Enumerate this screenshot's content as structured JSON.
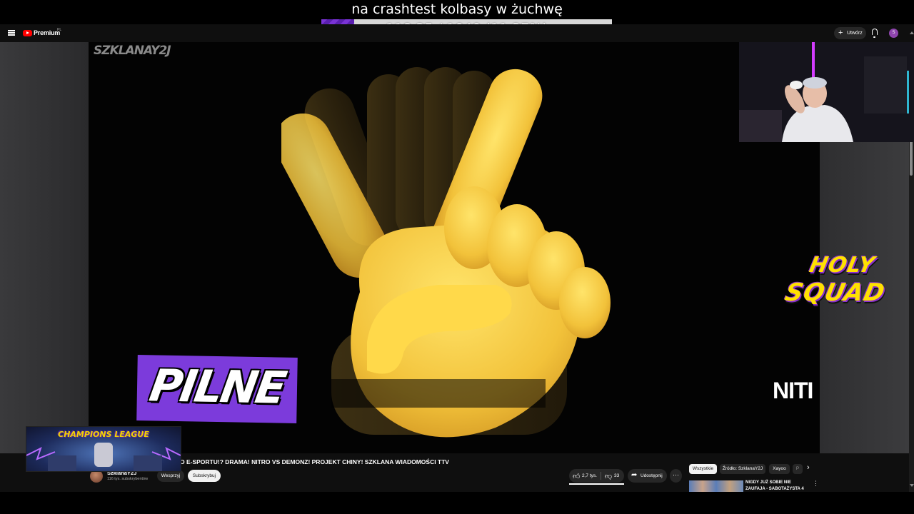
{
  "overlay": {
    "title": "na crashtest kolbasy w żuchwę",
    "progress_text": "118.25 / 1040 (11.37%)",
    "progress_fraction": 0.1137
  },
  "topbar": {
    "logo_text": "Premium",
    "country_code": "PL",
    "create_label": "Utwórz",
    "avatar_letter": "S"
  },
  "player": {
    "watermark": "SZKLANAY2J",
    "banner_text": "PILNE",
    "marquee_text": "NITI",
    "logo_line1": "HOLY",
    "logo_line2": "SQUAD"
  },
  "video": {
    "title": "O E-SPORTU!? DRAMA! NITRO VS DEMONZ! PROJEKT CHINY! SZKLANA WIADOMOŚCI TTV",
    "channel_name": "SzklanaY2J",
    "channel_subs": "116 tys. subskrybentów",
    "join_label": "Wesprzyj",
    "subscribe_label": "Subskrybuj",
    "likes": "2,7 tys.",
    "dislikes": "33",
    "share_label": "Udostępnij"
  },
  "chips": [
    "Wszystkie",
    "Źródło: SzklanaY2J",
    "Xayoo",
    "P"
  ],
  "recommendation": {
    "title": "NIGDY JUŻ SOBIE NIE ZAUFAJA - SABOTAŻYSTA 4"
  },
  "champions": {
    "text": "CHAMPIONS LEAGUE"
  },
  "colors": {
    "accent_purple": "#7c3bdb",
    "logo_yellow": "#ffe100",
    "youtube_red": "#ff0000"
  }
}
